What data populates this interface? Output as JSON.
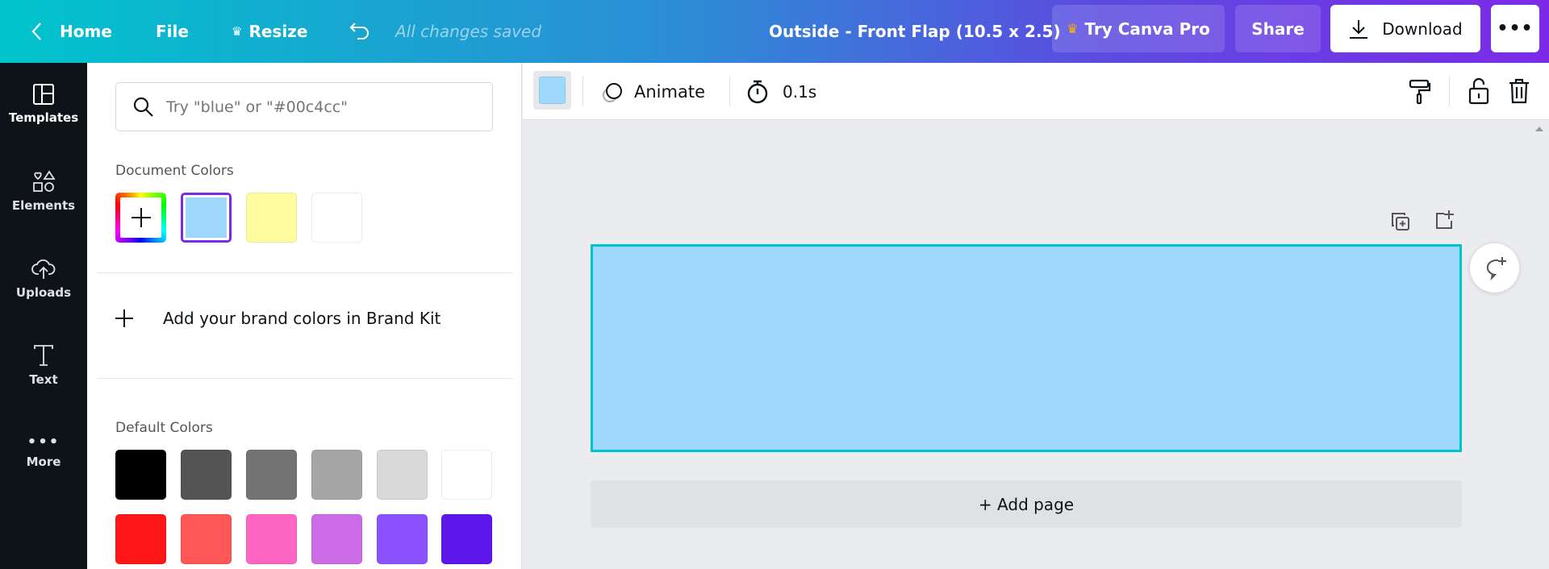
{
  "header": {
    "home": "Home",
    "file": "File",
    "resize": "Resize",
    "status": "All changes saved",
    "title": "Outside - Front Flap (10.5 x 2.5)",
    "try_pro": "Try Canva Pro",
    "share": "Share",
    "download": "Download"
  },
  "sidebar": {
    "items": [
      {
        "label": "Templates"
      },
      {
        "label": "Elements"
      },
      {
        "label": "Uploads"
      },
      {
        "label": "Text"
      },
      {
        "label": "More"
      }
    ]
  },
  "panel": {
    "search_placeholder": "Try \"blue\" or \"#00c4cc\"",
    "document_colors_label": "Document Colors",
    "document_colors": [
      "#9ed8fc",
      "#fffca0",
      "#ffffff"
    ],
    "selected_color": "#9ed8fc",
    "brand_kit": "Add your brand colors in Brand Kit",
    "default_colors_label": "Default Colors",
    "default_colors": [
      [
        "#000000",
        "#545454",
        "#737373",
        "#a6a6a6",
        "#d9d9d9",
        "#ffffff"
      ],
      [
        "#ff1616",
        "#ff5757",
        "#ff66c4",
        "#cb6ce6",
        "#8c52ff",
        "#5e17eb"
      ]
    ]
  },
  "toolbar": {
    "animate": "Animate",
    "duration": "0.1s"
  },
  "canvas": {
    "fill": "#9ed8fc",
    "selection": "#00c4cc",
    "add_page": "+ Add page"
  }
}
